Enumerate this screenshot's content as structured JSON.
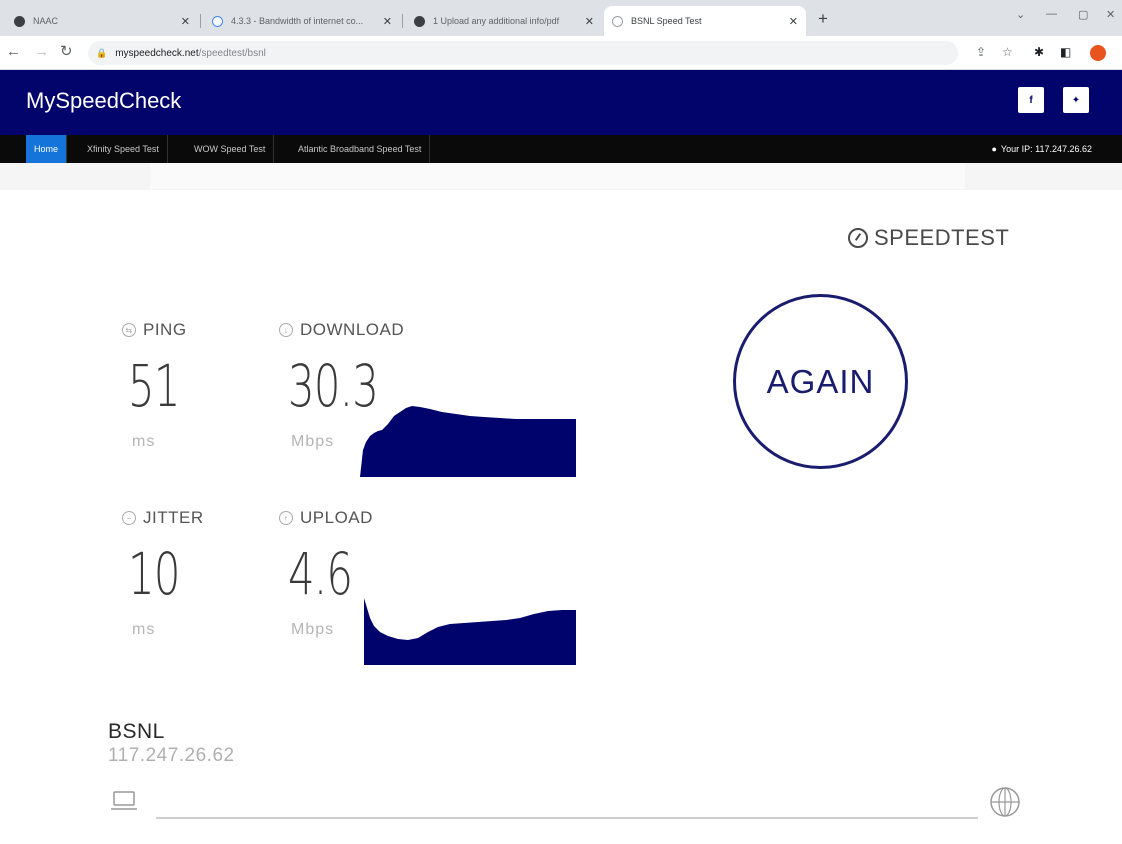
{
  "browser": {
    "tabs": [
      {
        "label": "NAAC",
        "icon": "globe-icon"
      },
      {
        "label": "4.3.3 - Bandwidth of internet co...",
        "icon": "google-icon"
      },
      {
        "label": "1 Upload any additional info/pdf",
        "icon": "globe-icon"
      },
      {
        "label": "BSNL Speed Test",
        "icon": "clock-icon"
      }
    ],
    "url_host": "myspeedcheck.net",
    "url_path": "/speedtest/bsnl"
  },
  "site": {
    "brand": "MySpeedCheck",
    "social": {
      "facebook": "f",
      "twitter": "✦"
    },
    "nav": [
      "Home",
      "Xfinity Speed Test",
      "WOW Speed Test",
      "Atlantic Broadband Speed Test"
    ],
    "ip_info": "Your IP: 117.247.26.62"
  },
  "speedtest": {
    "logo": "SPEEDTEST",
    "ping": {
      "label": "PING",
      "value": "51",
      "unit": "ms"
    },
    "download": {
      "label": "DOWNLOAD",
      "value": "30.3",
      "unit": "Mbps"
    },
    "jitter": {
      "label": "JITTER",
      "value": "10",
      "unit": "ms"
    },
    "upload": {
      "label": "UPLOAD",
      "value": "4.6",
      "unit": "Mbps"
    },
    "again_label": "AGAIN",
    "isp": {
      "name": "BSNL",
      "ip": "117.247.26.62"
    },
    "graph_color": "#00036b",
    "accent": "#1a1c6e"
  }
}
